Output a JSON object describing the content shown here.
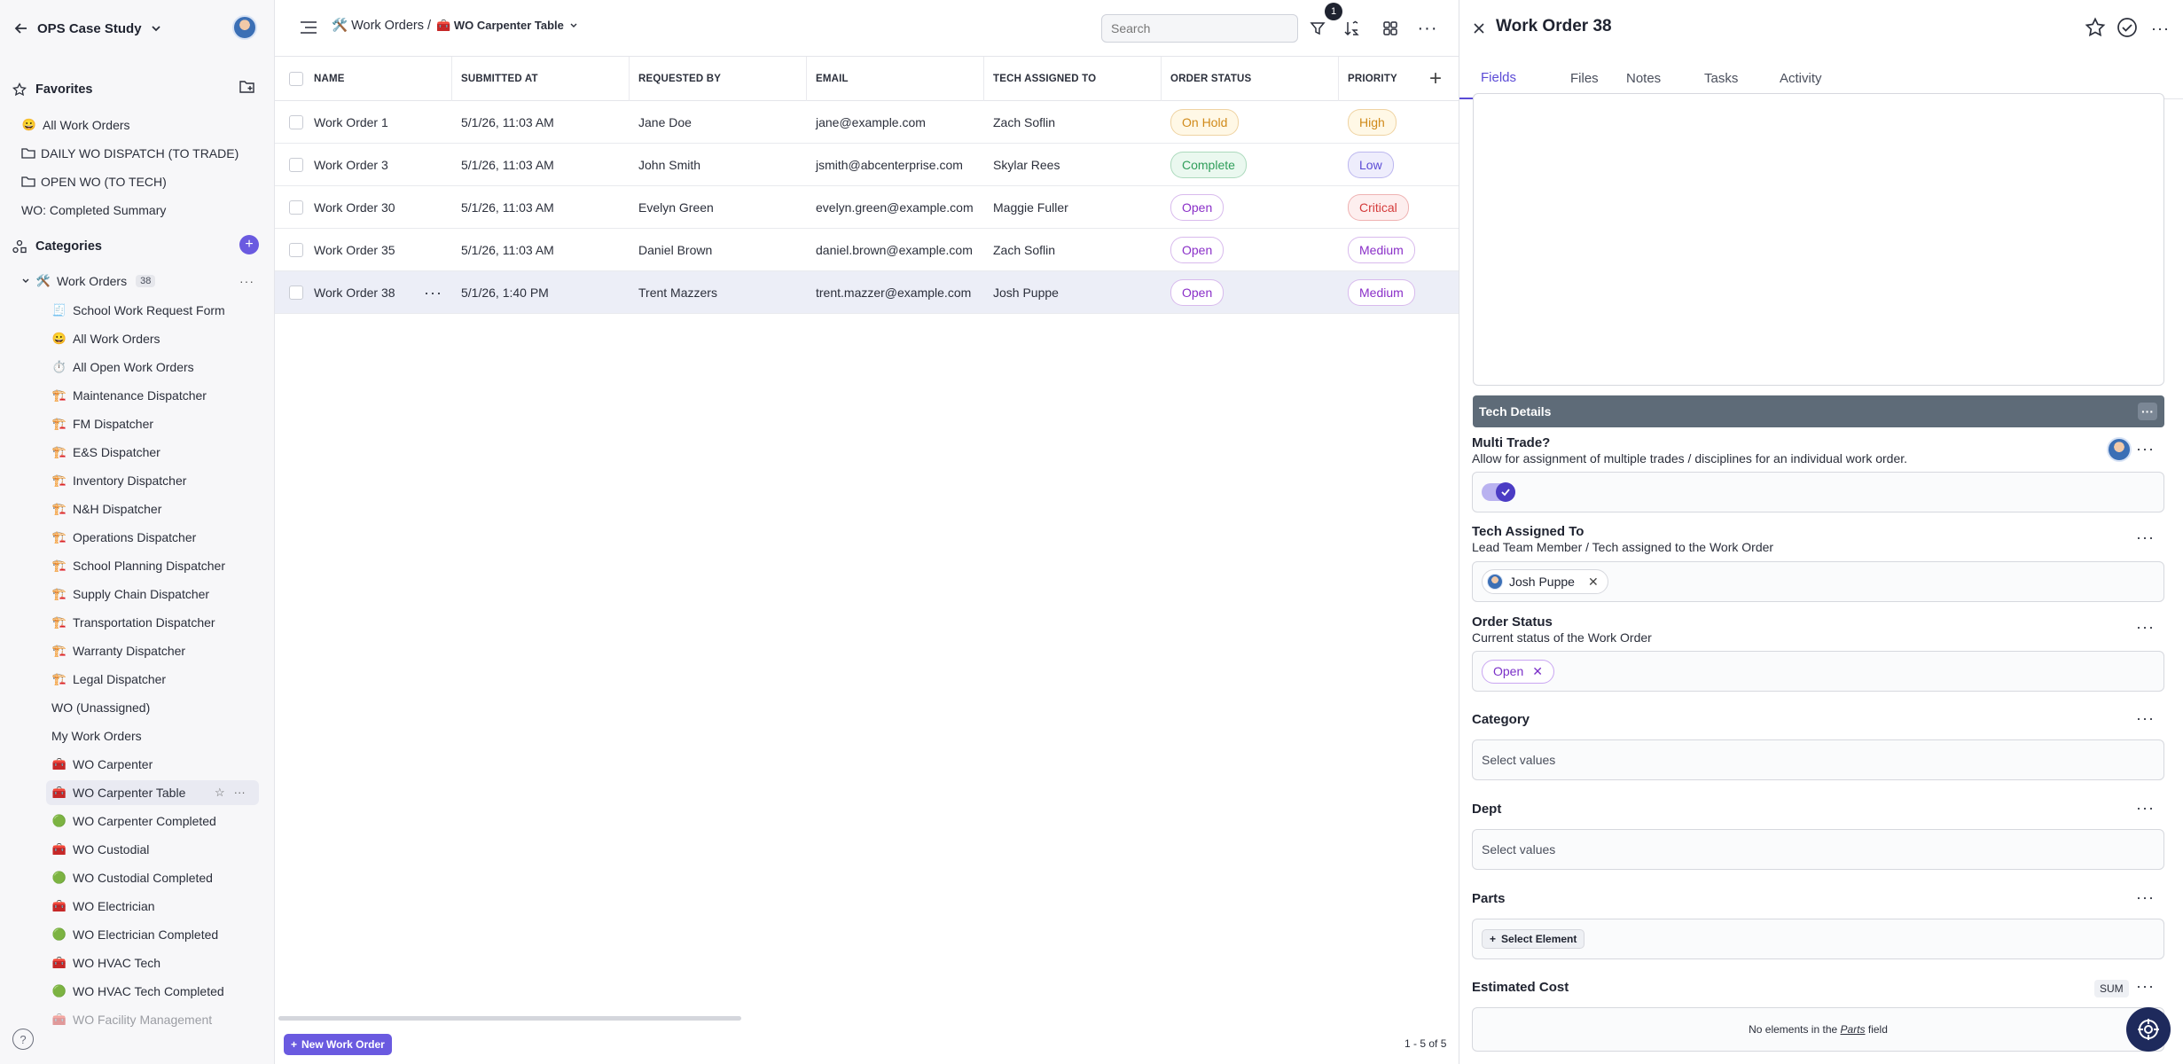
{
  "workspace": {
    "name": "OPS Case Study"
  },
  "sidebar": {
    "favorites_label": "Favorites",
    "favorites": [
      {
        "emoji": "😀",
        "label": "All Work Orders"
      },
      {
        "emoji": "folder",
        "label": "DAILY WO DISPATCH (TO TRADE)"
      },
      {
        "emoji": "folder",
        "label": "OPEN WO (TO TECH)"
      },
      {
        "emoji": "",
        "label": "WO: Completed Summary"
      }
    ],
    "categories_label": "Categories",
    "group": {
      "emoji": "🛠️",
      "label": "Work Orders",
      "count": "38"
    },
    "items": [
      {
        "emoji": "🧾",
        "label": "School Work Request Form"
      },
      {
        "emoji": "😀",
        "label": "All Work Orders"
      },
      {
        "emoji": "⏱️",
        "label": "All Open Work Orders"
      },
      {
        "emoji": "🏗️",
        "label": "Maintenance Dispatcher"
      },
      {
        "emoji": "🏗️",
        "label": "FM Dispatcher"
      },
      {
        "emoji": "🏗️",
        "label": "E&S Dispatcher"
      },
      {
        "emoji": "🏗️",
        "label": "Inventory Dispatcher"
      },
      {
        "emoji": "🏗️",
        "label": "N&H Dispatcher"
      },
      {
        "emoji": "🏗️",
        "label": "Operations Dispatcher"
      },
      {
        "emoji": "🏗️",
        "label": "School Planning Dispatcher"
      },
      {
        "emoji": "🏗️",
        "label": "Supply Chain Dispatcher"
      },
      {
        "emoji": "🏗️",
        "label": "Transportation Dispatcher"
      },
      {
        "emoji": "🏗️",
        "label": "Warranty Dispatcher"
      },
      {
        "emoji": "🏗️",
        "label": "Legal Dispatcher"
      },
      {
        "emoji": "",
        "label": "WO (Unassigned)"
      },
      {
        "emoji": "",
        "label": "My Work Orders"
      },
      {
        "emoji": "🧰",
        "label": "WO Carpenter"
      },
      {
        "emoji": "🧰",
        "label": "WO Carpenter Table"
      },
      {
        "emoji": "🟢",
        "label": "WO Carpenter Completed"
      },
      {
        "emoji": "🧰",
        "label": "WO Custodial"
      },
      {
        "emoji": "🟢",
        "label": "WO Custodial Completed"
      },
      {
        "emoji": "🧰",
        "label": "WO Electrician"
      },
      {
        "emoji": "🟢",
        "label": "WO Electrician Completed"
      },
      {
        "emoji": "🧰",
        "label": "WO HVAC Tech"
      },
      {
        "emoji": "🟢",
        "label": "WO HVAC Tech Completed"
      },
      {
        "emoji": "🧰",
        "label": "WO Facility Management"
      }
    ]
  },
  "header": {
    "crumb_root": "🛠️ Work Orders /",
    "crumb_current": "🧰 WO Carpenter Table",
    "search_placeholder": "Search",
    "filter_count": "1"
  },
  "table": {
    "columns": [
      "NAME",
      "SUBMITTED AT",
      "REQUESTED BY",
      "EMAIL",
      "TECH ASSIGNED TO",
      "ORDER STATUS",
      "PRIORITY"
    ],
    "rows": [
      {
        "name": "Work Order 1",
        "submitted": "5/1/26, 11:03 AM",
        "requested_by": "Jane Doe",
        "email": "jane@example.com",
        "tech": "Zach Soflin",
        "status": "On Hold",
        "priority": "High"
      },
      {
        "name": "Work Order 3",
        "submitted": "5/1/26, 11:03 AM",
        "requested_by": "John Smith",
        "email": "jsmith@abcenterprise.com",
        "tech": "Skylar Rees",
        "status": "Complete",
        "priority": "Low"
      },
      {
        "name": "Work Order 30",
        "submitted": "5/1/26, 11:03 AM",
        "requested_by": "Evelyn Green",
        "email": "evelyn.green@example.com",
        "tech": "Maggie Fuller",
        "status": "Open",
        "priority": "Critical"
      },
      {
        "name": "Work Order 35",
        "submitted": "5/1/26, 11:03 AM",
        "requested_by": "Daniel Brown",
        "email": "daniel.brown@example.com",
        "tech": "Zach Soflin",
        "status": "Open",
        "priority": "Medium"
      },
      {
        "name": "Work Order 38",
        "submitted": "5/1/26, 1:40 PM",
        "requested_by": "Trent Mazzers",
        "email": "trent.mazzer@example.com",
        "tech": "Josh Puppe",
        "status": "Open",
        "priority": "Medium"
      }
    ],
    "new_button": "New Work Order",
    "pager": "1 - 5 of 5"
  },
  "detail": {
    "title": "Work Order 38",
    "tabs": [
      "Fields",
      "Files",
      "Notes",
      "Tasks",
      "Activity"
    ],
    "section_title": "Tech Details",
    "fields": {
      "multi_trade_label": "Multi Trade?",
      "multi_trade_desc": "Allow for assignment of multiple trades / disciplines for an individual work order.",
      "tech_label": "Tech Assigned To",
      "tech_desc": "Lead Team Member / Tech assigned to the Work Order",
      "tech_value": "Josh Puppe",
      "status_label": "Order Status",
      "status_desc": "Current status of the Work Order",
      "status_value": "Open",
      "category_label": "Category",
      "category_placeholder": "Select values",
      "dept_label": "Dept",
      "dept_placeholder": "Select values",
      "parts_label": "Parts",
      "parts_button": "Select Element",
      "cost_label": "Estimated Cost",
      "cost_agg": "SUM",
      "cost_empty_pre": "No elements in the",
      "cost_empty_field": "Parts",
      "cost_empty_post": "field"
    }
  },
  "colors": {
    "accent": "#6a5ae0",
    "on_hold": "#d08a1a",
    "complete": "#2f9e5a",
    "open": "#8a2fc8",
    "high": "#d08a1a",
    "low": "#5b4bd6",
    "critical": "#d43b3b",
    "medium": "#8a2fc8"
  }
}
